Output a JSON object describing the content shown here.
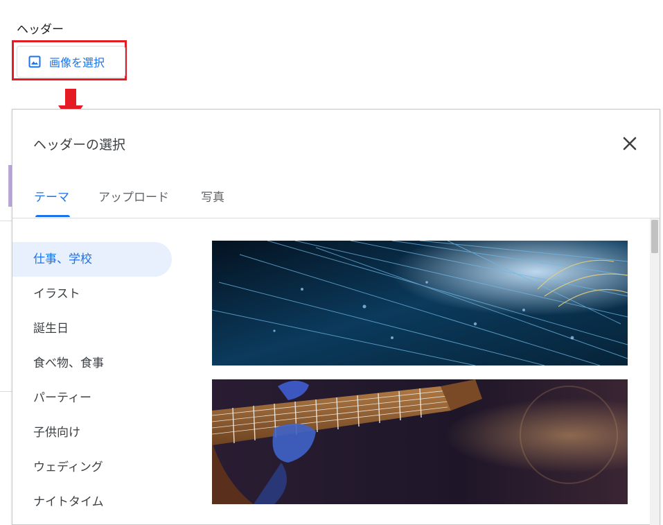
{
  "page": {
    "section_label": "ヘッダー",
    "select_image_button": "画像を選択",
    "icons": {
      "select_image": "image-icon",
      "annotation": "red-down-arrow-icon",
      "close": "close-icon"
    },
    "colors": {
      "accent": "#1a73e8",
      "annotation": "#e51b23"
    }
  },
  "dialog": {
    "title": "ヘッダーの選択",
    "tabs": [
      {
        "label": "テーマ",
        "active": true
      },
      {
        "label": "アップロード",
        "active": false
      },
      {
        "label": "写真",
        "active": false
      }
    ],
    "categories": [
      {
        "label": "仕事、学校",
        "active": true
      },
      {
        "label": "イラスト",
        "active": false
      },
      {
        "label": "誕生日",
        "active": false
      },
      {
        "label": "食べ物、食事",
        "active": false
      },
      {
        "label": "パーティー",
        "active": false
      },
      {
        "label": "子供向け",
        "active": false
      },
      {
        "label": "ウェディング",
        "active": false
      },
      {
        "label": "ナイトタイム",
        "active": false
      }
    ],
    "thumbnails": [
      {
        "subject": "abstract blue fiber-optic light streaks"
      },
      {
        "subject": "electric guitar neck held by hand on stage"
      }
    ]
  }
}
